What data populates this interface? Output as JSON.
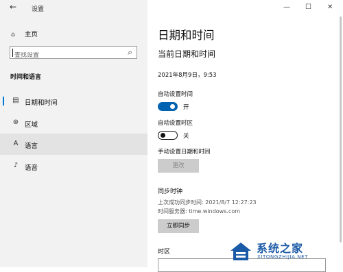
{
  "window": {
    "title": "设置",
    "minimize": "—",
    "maximize": "☐",
    "close": "✕"
  },
  "sidebar": {
    "back_icon": "←",
    "home": {
      "icon": "⌂",
      "label": "主页"
    },
    "search": {
      "placeholder": "查找设置",
      "icon": "⌕"
    },
    "section_title": "时间和语言",
    "items": [
      {
        "icon": "▤",
        "label": "日期和时间",
        "active": false,
        "indicator": true
      },
      {
        "icon": "⊛",
        "label": "区域",
        "active": false
      },
      {
        "icon": "A",
        "label": "语言",
        "active": true
      },
      {
        "icon": "♪",
        "label": "语音",
        "active": false
      }
    ]
  },
  "main": {
    "page_title": "日期和时间",
    "sub_title": "当前日期和时间",
    "current_datetime": "2021年8月9日，9:53",
    "auto_time": {
      "label": "自动设置时间",
      "state": "开",
      "on": true
    },
    "auto_timezone": {
      "label": "自动设置时区",
      "state": "关",
      "on": false
    },
    "manual": {
      "label": "手动设置日期和时间",
      "button": "更改"
    },
    "sync": {
      "title": "同步时钟",
      "last_sync": "上次成功同步时间: 2021/8/7 12:27:23",
      "server": "时间服务器: time.windows.com",
      "button": "立即同步"
    },
    "timezone": {
      "label": "时区"
    }
  },
  "watermark": {
    "text": "系统之家",
    "sub": "XITONGZHIJIA.NET"
  },
  "colors": {
    "accent": "#0063b1",
    "watermark": "#1b5aa6"
  }
}
